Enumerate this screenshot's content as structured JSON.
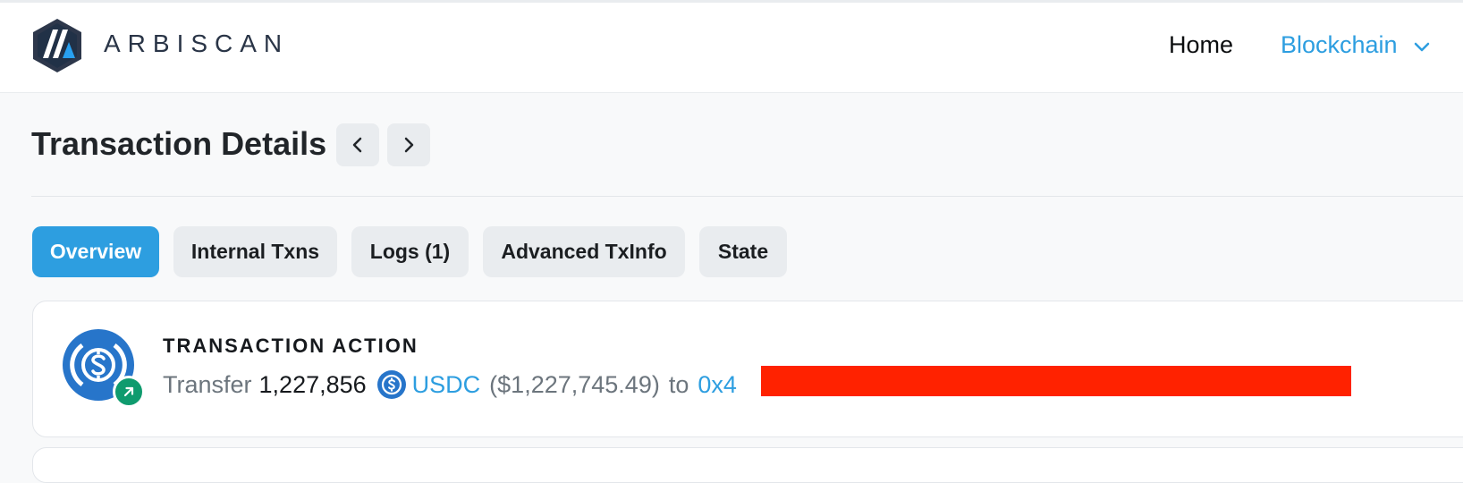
{
  "header": {
    "brand": "ARBISCAN",
    "nav": {
      "home": "Home",
      "blockchain": "Blockchain"
    }
  },
  "page": {
    "title": "Transaction Details"
  },
  "tabs": [
    {
      "label": "Overview",
      "active": true
    },
    {
      "label": "Internal Txns",
      "active": false
    },
    {
      "label": "Logs (1)",
      "active": false
    },
    {
      "label": "Advanced TxInfo",
      "active": false
    },
    {
      "label": "State",
      "active": false
    }
  ],
  "action": {
    "heading": "TRANSACTION ACTION",
    "verb": "Transfer",
    "amount": "1,227,856",
    "token": "USDC",
    "usd_value": "($1,227,745.49)",
    "to_word": "to",
    "recipient_prefix": "0x4"
  },
  "icons": {
    "logo": "arbiscan-logo-icon",
    "prev": "chevron-left-icon",
    "next": "chevron-right-icon",
    "dropdown": "chevron-down-icon",
    "token": "usdc-coin-icon",
    "badge": "arrow-up-right-icon"
  },
  "colors": {
    "accent": "#2d9ee0",
    "usdc": "#2775ca",
    "badge": "#0f9b6e",
    "redaction": "#ff2200"
  }
}
